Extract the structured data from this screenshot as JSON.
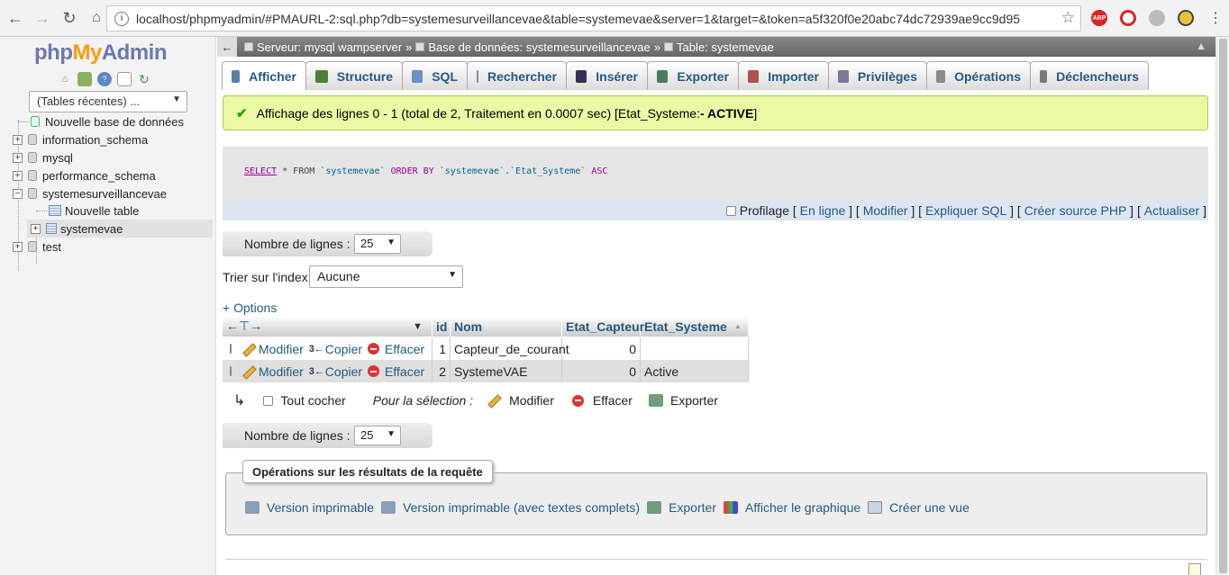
{
  "browser": {
    "url": "localhost/phpmyadmin/#PMAURL-2:sql.php?db=systemesurveillancevae&table=systemevae&server=1&target=&token=a5f320f0e20abc74dc72939ae9cc9d95",
    "url_info": "i",
    "ext_abp": "ABP"
  },
  "logo": {
    "php": "php",
    "my": "My",
    "admin": "Admin"
  },
  "sidebar": {
    "recent": "(Tables récentes) ...",
    "tree": [
      {
        "label": "Nouvelle base de données"
      },
      {
        "label": "information_schema"
      },
      {
        "label": "mysql"
      },
      {
        "label": "performance_schema"
      },
      {
        "label": "systemesurveillancevae"
      },
      {
        "label": "Nouvelle table"
      },
      {
        "label": "systemevae"
      },
      {
        "label": "test"
      }
    ]
  },
  "breadcrumb": {
    "server": "Serveur: mysql wampserver",
    "database": "Base de données: systemesurveillancevae",
    "table": "Table: systemevae",
    "sep": "»"
  },
  "tabs": [
    {
      "label": "Afficher",
      "color": "#5b7fa8"
    },
    {
      "label": "Structure",
      "color": "#4d7d3c"
    },
    {
      "label": "SQL",
      "color": "#6a8fbf"
    },
    {
      "label": "Rechercher",
      "color": "#7a8fa8"
    },
    {
      "label": "Insérer",
      "color": "#335"
    },
    {
      "label": "Exporter",
      "color": "#4a7d5c"
    },
    {
      "label": "Importer",
      "color": "#b05050"
    },
    {
      "label": "Privilèges",
      "color": "#7a7a9a"
    },
    {
      "label": "Opérations",
      "color": "#8a8a8a"
    },
    {
      "label": "Déclencheurs",
      "color": "#7a7a7a"
    }
  ],
  "message": {
    "text": "Affichage des lignes 0 - 1 (total de 2, Traitement en 0.0007 sec) [Etat_Systeme: ",
    "bold": "- ACTIVE",
    "close": "]"
  },
  "sql": {
    "select": "SELECT",
    "part1": " * FROM ",
    "table": "`systemevae`",
    "orderby": " ORDER BY ",
    "column": "`systemevae`.`Etat_Systeme`",
    "asc": " ASC"
  },
  "sql_links": {
    "profilage": "Profilage",
    "en_ligne": "En ligne",
    "modifier": "Modifier",
    "expliquer": "Expliquer SQL",
    "creer_source": "Créer source PHP",
    "actualiser": "Actualiser"
  },
  "rows": {
    "label": "Nombre de lignes :",
    "value": "25"
  },
  "sort": {
    "label": "Trier sur l'index:",
    "value": "Aucune"
  },
  "options_label": "+ Options",
  "table": {
    "headers": [
      "id",
      "Nom",
      "Etat_Capteur",
      "Etat_Systeme"
    ],
    "sort_indicator": "▲",
    "actions": {
      "edit": "Modifier",
      "copy": "Copier",
      "delete": "Effacer"
    },
    "rows": [
      {
        "id": "1",
        "nom": "Capteur_de_courant",
        "etat_capteur": "0",
        "etat_systeme": ""
      },
      {
        "id": "2",
        "nom": "SystemeVAE",
        "etat_capteur": "0",
        "etat_systeme": "Active"
      }
    ]
  },
  "with_selection": {
    "check_all": "Tout cocher",
    "for_selection": "Pour la sélection :",
    "edit": "Modifier",
    "delete": "Effacer",
    "export": "Exporter"
  },
  "query_ops": {
    "legend": "Opérations sur les résultats de la requête",
    "links": [
      "Version imprimable",
      "Version imprimable (avec textes complets)",
      "Exporter",
      "Afficher le graphique",
      "Créer une vue"
    ]
  }
}
